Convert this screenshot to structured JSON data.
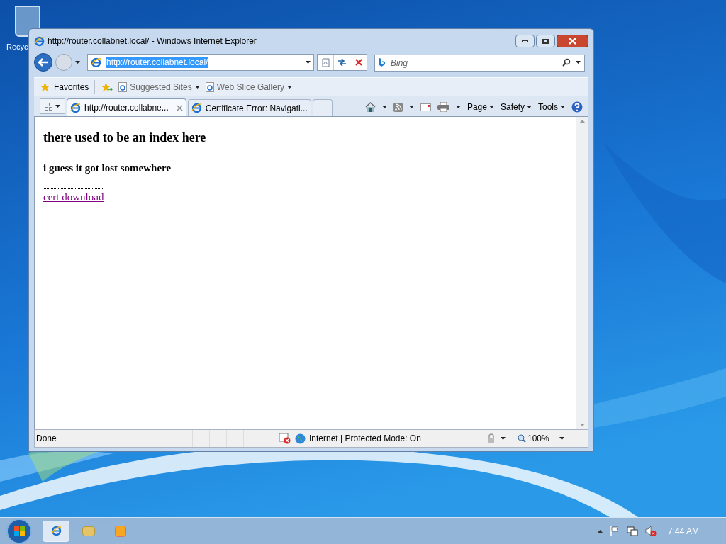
{
  "desktop": {
    "icons": [
      {
        "label": "Recyc"
      }
    ]
  },
  "window": {
    "title": "http://router.collabnet.local/ - Windows Internet Explorer"
  },
  "address_bar": {
    "value": "http://router.collabnet.local/"
  },
  "search": {
    "placeholder": "Bing"
  },
  "favorites_bar": {
    "items": [
      {
        "label": "Favorites",
        "kind": "favorites"
      },
      {
        "label": "Suggested Sites",
        "kind": "link"
      },
      {
        "label": "Web Slice Gallery",
        "kind": "link"
      }
    ]
  },
  "tabs": [
    {
      "label": "http://router.collabne...",
      "selected": true
    },
    {
      "label": "Certificate Error: Navigati...",
      "selected": false
    }
  ],
  "command_bar": [
    "Page",
    "Safety",
    "Tools"
  ],
  "page": {
    "heading": "there used to be an index here",
    "subheading": "i guess it got lost somewhere",
    "link": "cert download"
  },
  "status_bar": {
    "status": "Done",
    "zone": "Internet | Protected Mode: On",
    "zoom": "100%"
  },
  "taskbar": {
    "clock": "7:44 AM"
  }
}
